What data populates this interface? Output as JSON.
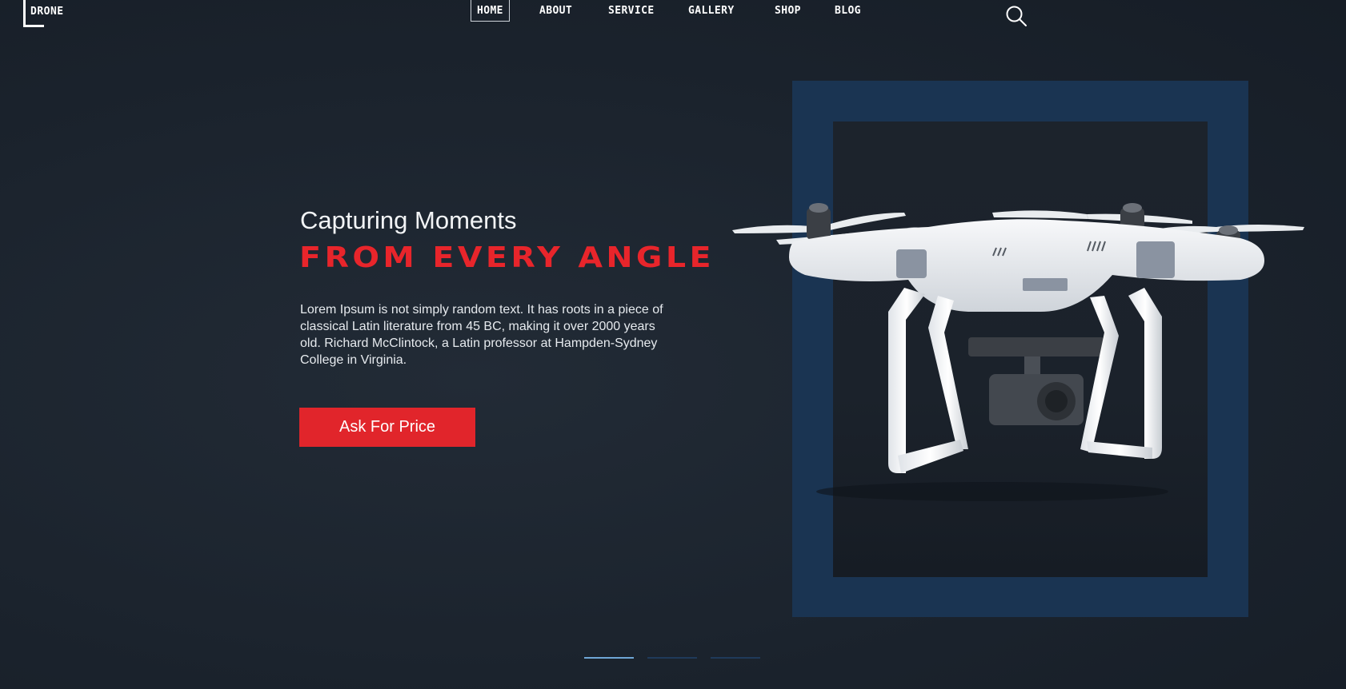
{
  "brand": {
    "logo_text": "DRONE"
  },
  "nav": {
    "items": [
      {
        "label": "HOME",
        "active": true
      },
      {
        "label": "ABOUT"
      },
      {
        "label": "SERVICE"
      },
      {
        "label": "GALLERY"
      },
      {
        "label": "SHOP"
      },
      {
        "label": "BLOG"
      }
    ],
    "search_icon": "search-icon"
  },
  "hero": {
    "subtitle": "Capturing Moments",
    "headline": "FROM EVERY ANGLE",
    "description": "Lorem Ipsum is not simply random text. It has roots in a piece of classical Latin literature from 45 BC, making it over 2000 years old. Richard McClintock, a Latin professor at Hampden-Sydney College in Virginia.",
    "cta_label": "Ask For Price"
  },
  "slider": {
    "count": 3,
    "active_index": 0
  },
  "colors": {
    "accent": "#e1252b",
    "frame": "#1a3452",
    "background": "#1c232d",
    "dot_active": "#6fa6d6"
  }
}
